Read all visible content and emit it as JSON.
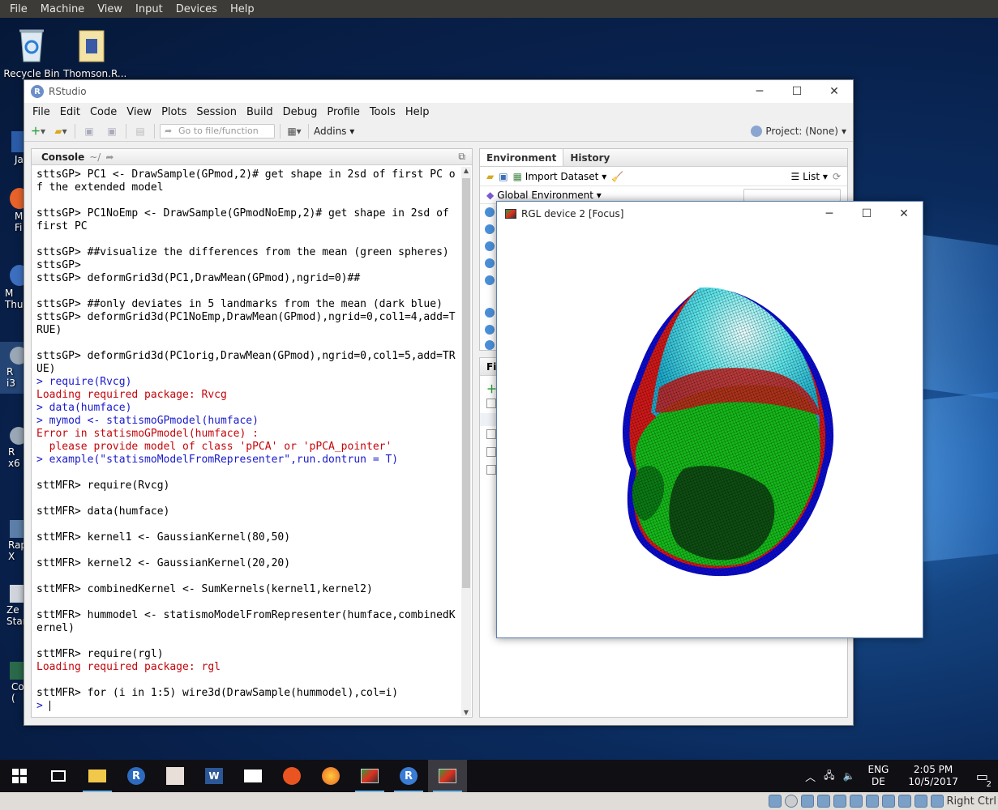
{
  "vbox_menu": [
    "File",
    "Machine",
    "View",
    "Input",
    "Devices",
    "Help"
  ],
  "desktop_icons": [
    {
      "label": "Recycle Bin",
      "icon": "recycle-bin-icon"
    },
    {
      "label": "Thomson.R...",
      "icon": "folder-icon"
    }
  ],
  "left_strip_labels": [
    "Ja",
    "M\nFi",
    "M\nThur",
    "R i3",
    "R x6",
    "Rap\nX",
    "Ze\nStar",
    "Co\n("
  ],
  "rstudio": {
    "title": "RStudio",
    "menu": [
      "File",
      "Edit",
      "Code",
      "View",
      "Plots",
      "Session",
      "Build",
      "Debug",
      "Profile",
      "Tools",
      "Help"
    ],
    "goto_placeholder": "Go to file/function",
    "addins_label": "Addins",
    "project_label": "Project: (None)",
    "console": {
      "tab_label": "Console",
      "path": "~/",
      "lines": [
        {
          "t": "out",
          "text": "sttsGP> PC1 <- DrawSample(GPmod,2)# get shape in 2sd of first PC of the extended model"
        },
        {
          "t": "blank",
          "text": ""
        },
        {
          "t": "out",
          "text": "sttsGP> PC1NoEmp <- DrawSample(GPmodNoEmp,2)# get shape in 2sd of first PC"
        },
        {
          "t": "blank",
          "text": ""
        },
        {
          "t": "out",
          "text": "sttsGP> ##visualize the differences from the mean (green spheres)"
        },
        {
          "t": "out",
          "text": "sttsGP> "
        },
        {
          "t": "out",
          "text": "sttsGP> deformGrid3d(PC1,DrawMean(GPmod),ngrid=0)##"
        },
        {
          "t": "blank",
          "text": ""
        },
        {
          "t": "out",
          "text": "sttsGP> ##only deviates in 5 landmarks from the mean (dark blue)"
        },
        {
          "t": "out",
          "text": "sttsGP> deformGrid3d(PC1NoEmp,DrawMean(GPmod),ngrid=0,col1=4,add=TRUE)"
        },
        {
          "t": "blank",
          "text": ""
        },
        {
          "t": "out",
          "text": "sttsGP> deformGrid3d(PC1orig,DrawMean(GPmod),ngrid=0,col1=5,add=TRUE)"
        },
        {
          "t": "cmd",
          "text": "> require(Rvcg)"
        },
        {
          "t": "err",
          "text": "Loading required package: Rvcg"
        },
        {
          "t": "cmd",
          "text": "> data(humface)"
        },
        {
          "t": "cmd",
          "text": "> mymod <- statismoGPmodel(humface)"
        },
        {
          "t": "err",
          "text": "Error in statismoGPmodel(humface) : "
        },
        {
          "t": "err",
          "text": "  please provide model of class 'pPCA' or 'pPCA_pointer'"
        },
        {
          "t": "cmd",
          "text": "> example(\"statismoModelFromRepresenter\",run.dontrun = T)"
        },
        {
          "t": "blank",
          "text": ""
        },
        {
          "t": "out",
          "text": "sttMFR> require(Rvcg)"
        },
        {
          "t": "blank",
          "text": ""
        },
        {
          "t": "out",
          "text": "sttMFR> data(humface)"
        },
        {
          "t": "blank",
          "text": ""
        },
        {
          "t": "out",
          "text": "sttMFR> kernel1 <- GaussianKernel(80,50)"
        },
        {
          "t": "blank",
          "text": ""
        },
        {
          "t": "out",
          "text": "sttMFR> kernel2 <- GaussianKernel(20,20)"
        },
        {
          "t": "blank",
          "text": ""
        },
        {
          "t": "out",
          "text": "sttMFR> combinedKernel <- SumKernels(kernel1,kernel2)"
        },
        {
          "t": "blank",
          "text": ""
        },
        {
          "t": "out",
          "text": "sttMFR> hummodel <- statismoModelFromRepresenter(humface,combinedKernel)"
        },
        {
          "t": "blank",
          "text": ""
        },
        {
          "t": "out",
          "text": "sttMFR> require(rgl)"
        },
        {
          "t": "err",
          "text": "Loading required package: rgl"
        },
        {
          "t": "blank",
          "text": ""
        },
        {
          "t": "out",
          "text": "sttMFR> for (i in 1:5) wire3d(DrawSample(hummodel),col=i)"
        },
        {
          "t": "cmd",
          "text": "> "
        }
      ]
    },
    "environment": {
      "tabs": [
        "Environment",
        "History"
      ],
      "import_label": "Import Dataset",
      "list_label": "List",
      "scope_label": "Global Environment"
    },
    "files": {
      "tab_fragment": "Fi"
    }
  },
  "rgl": {
    "title": "RGL device 2 [Focus]"
  },
  "taskbar": {
    "apps": [
      "start",
      "task-view",
      "file-explorer",
      "r",
      "sampler",
      "word",
      "mail",
      "ubuntu",
      "firefox",
      "rgl",
      "r",
      "rgl-active"
    ],
    "lang": "ENG",
    "layout": "DE",
    "time": "2:05 PM",
    "date": "10/5/2017",
    "notif_count": "2"
  },
  "vbox_status": {
    "host_key": "Right Ctrl"
  }
}
